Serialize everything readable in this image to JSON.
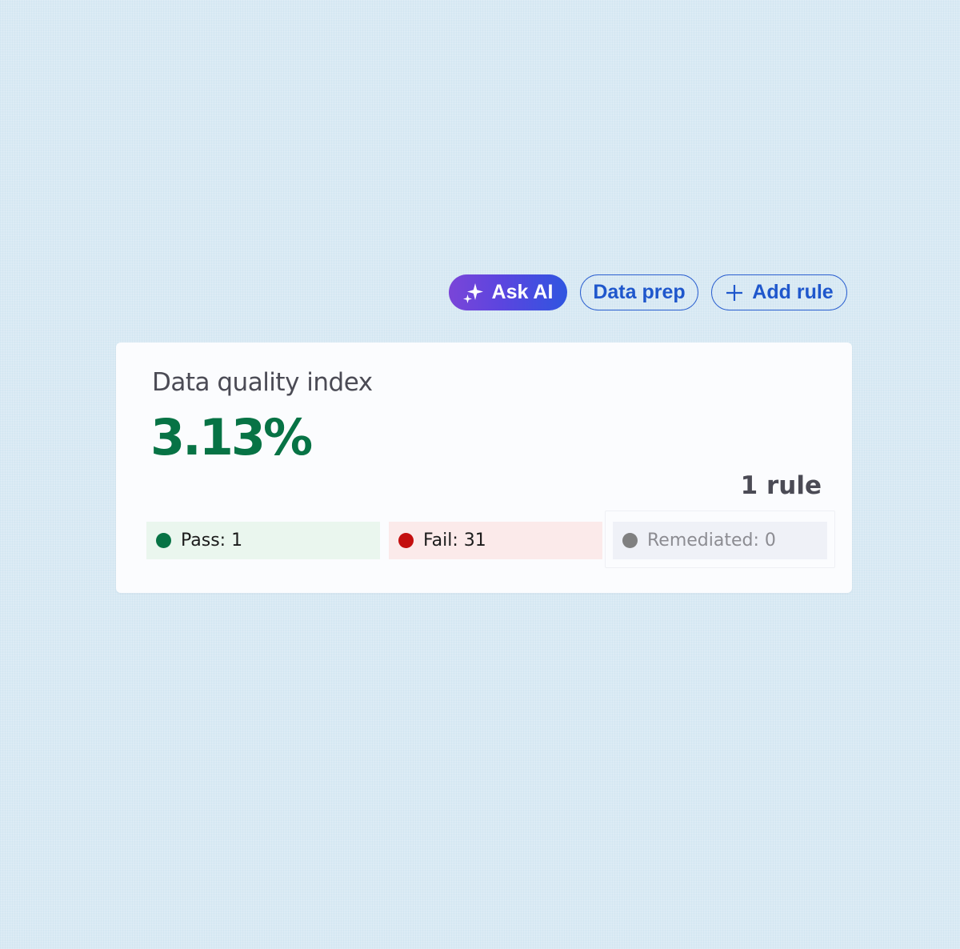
{
  "toolbar": {
    "ask_ai_label": "Ask AI",
    "data_prep_label": "Data prep",
    "add_rule_label": "Add rule"
  },
  "card": {
    "title": "Data quality index",
    "index_value": "3.13%",
    "rule_count": "1 rule",
    "statuses": [
      {
        "label": "Pass: 1",
        "color": "#077345"
      },
      {
        "label": "Fail: 31",
        "color": "#c40f0f"
      },
      {
        "label": "Remediated: 0",
        "color": "#808080"
      }
    ]
  },
  "colors": {
    "accent_blue": "#1f57cc",
    "success_green": "#077345",
    "ai_gradient_start": "#7a45d8",
    "ai_gradient_end": "#2f55e0"
  },
  "icons": {
    "ask_ai": "sparkle-icon",
    "add_rule": "plus-icon"
  }
}
